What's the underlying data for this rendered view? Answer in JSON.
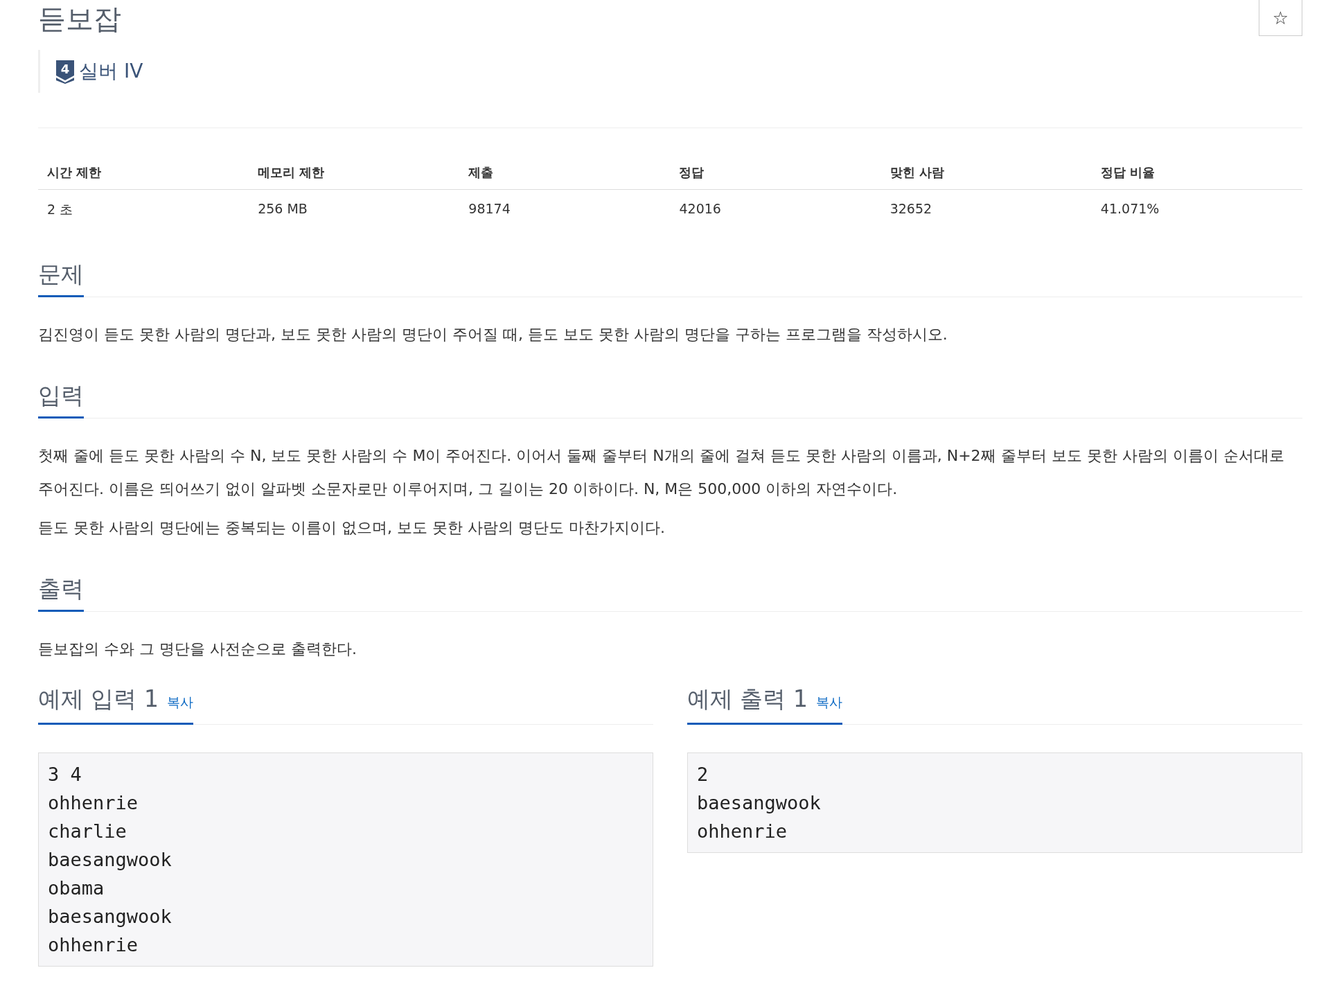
{
  "title": "듣보잡",
  "tier": {
    "icon_digit": "4",
    "label": "실버 IV"
  },
  "favorite": {
    "symbol": "☆"
  },
  "stats": {
    "columns": [
      "시간 제한",
      "메모리 제한",
      "제출",
      "정답",
      "맞힌 사람",
      "정답 비율"
    ],
    "row": [
      "2 초",
      "256 MB",
      "98174",
      "42016",
      "32652",
      "41.071%"
    ]
  },
  "sections": [
    {
      "heading": "문제",
      "paragraphs": [
        "김진영이 듣도 못한 사람의 명단과, 보도 못한 사람의 명단이 주어질 때, 듣도 보도 못한 사람의 명단을 구하는 프로그램을 작성하시오."
      ]
    },
    {
      "heading": "입력",
      "paragraphs": [
        "첫째 줄에 듣도 못한 사람의 수 N, 보도 못한 사람의 수 M이 주어진다. 이어서 둘째 줄부터 N개의 줄에 걸쳐 듣도 못한 사람의 이름과, N+2째 줄부터 보도 못한 사람의 이름이 순서대로 주어진다. 이름은 띄어쓰기 없이 알파벳 소문자로만 이루어지며, 그 길이는 20 이하이다. N, M은 500,000 이하의 자연수이다.",
        "듣도 못한 사람의 명단에는 중복되는 이름이 없으며, 보도 못한 사람의 명단도 마찬가지이다."
      ]
    },
    {
      "heading": "출력",
      "paragraphs": [
        "듣보잡의 수와 그 명단을 사전순으로 출력한다."
      ]
    }
  ],
  "samples": [
    {
      "heading": "예제 입력 1",
      "copy": "복사",
      "lines": [
        "3 4",
        "ohhenrie",
        "charlie",
        "baesangwook",
        "obama",
        "baesangwook",
        "ohhenrie"
      ]
    },
    {
      "heading": "예제 출력 1",
      "copy": "복사",
      "lines": [
        "2",
        "baesangwook",
        "ohhenrie"
      ]
    }
  ]
}
